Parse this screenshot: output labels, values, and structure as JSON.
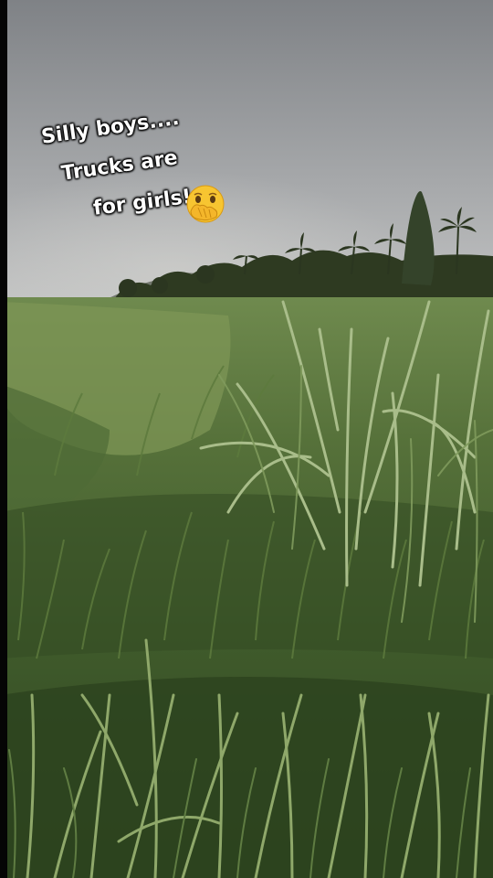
{
  "caption": {
    "line1": "Silly boys....",
    "line2": "Trucks are",
    "line3": "for girls!"
  },
  "emoji": {
    "name": "face-with-hand-over-mouth-peeking-icon"
  },
  "colors": {
    "sky_top": "#8a8d91",
    "sky_bottom": "#b9bbbd",
    "treeline": "#2f3a22",
    "grass_dark": "#2a3a1e",
    "grass_mid": "#4f6a33",
    "grass_light": "#8fa86a",
    "emoji_yellow": "#f7c531"
  }
}
